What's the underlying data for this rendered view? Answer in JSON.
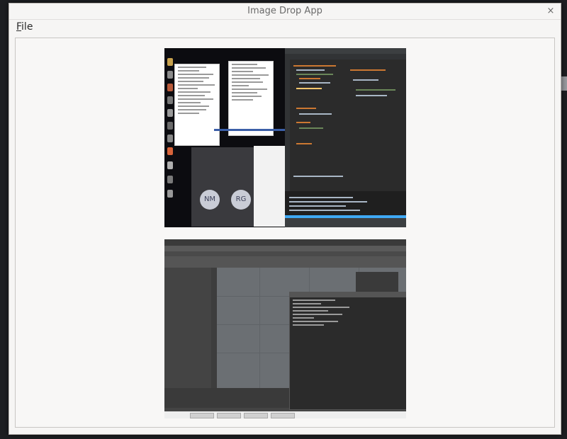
{
  "window": {
    "title": "Image Drop App",
    "close_glyph": "×"
  },
  "menubar": {
    "file": {
      "mnemonic": "F",
      "rest": "ile"
    }
  },
  "content": {
    "images": [
      {
        "kind": "dropped-screenshot",
        "avatars": [
          "NM",
          "RG"
        ]
      },
      {
        "kind": "dropped-screenshot"
      }
    ]
  }
}
